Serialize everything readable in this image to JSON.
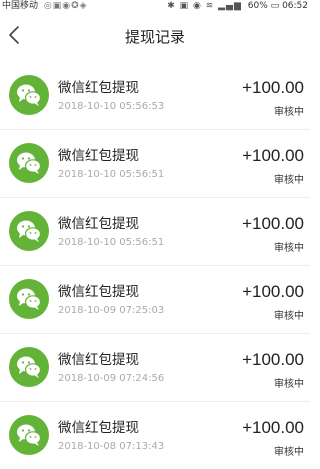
{
  "status_bar": {
    "carrier": "中国移动",
    "battery": "60%",
    "time": "06:52"
  },
  "header": {
    "title": "提现记录"
  },
  "records": [
    {
      "title": "微信红包提现",
      "time": "2018-10-10  05:56:53",
      "amount": "+100.00",
      "status": "审核中"
    },
    {
      "title": "微信红包提现",
      "time": "2018-10-10  05:56:51",
      "amount": "+100.00",
      "status": "审核中"
    },
    {
      "title": "微信红包提现",
      "time": "2018-10-10  05:56:51",
      "amount": "+100.00",
      "status": "审核中"
    },
    {
      "title": "微信红包提现",
      "time": "2018-10-09  07:25:03",
      "amount": "+100.00",
      "status": "审核中"
    },
    {
      "title": "微信红包提现",
      "time": "2018-10-09  07:24:56",
      "amount": "+100.00",
      "status": "审核中"
    },
    {
      "title": "微信红包提现",
      "time": "2018-10-08  07:13:43",
      "amount": "+100.00",
      "status": "审核中"
    }
  ],
  "icons": {
    "back": "chevron-left-icon",
    "record": "wechat-icon"
  },
  "colors": {
    "wechat_green": "#62b338",
    "background": "#ffffff"
  }
}
